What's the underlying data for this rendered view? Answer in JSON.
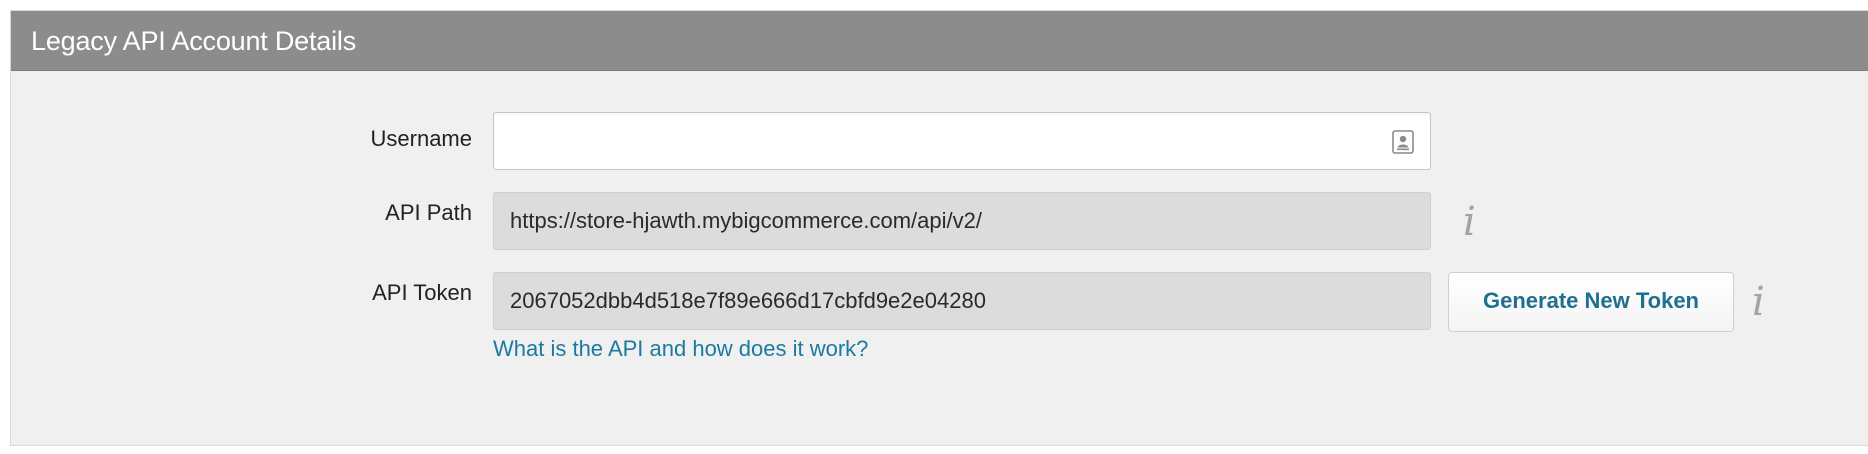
{
  "panel": {
    "title": "Legacy API Account Details"
  },
  "form": {
    "username": {
      "label": "Username",
      "value": "",
      "placeholder": ""
    },
    "api_path": {
      "label": "API Path",
      "value": "https://store-hjawth.mybigcommerce.com/api/v2/",
      "info_glyph": "i"
    },
    "api_token": {
      "label": "API Token",
      "value": "2067052dbb4d518e7f89e666d17cbfd9e2e04280",
      "generate_button": "Generate New Token",
      "info_glyph": "i"
    },
    "help_link": "What is the API and how does it work?"
  },
  "icons": {
    "username_field_icon": "contact-card-icon",
    "api_path_info": "info-icon",
    "api_token_info": "info-icon"
  },
  "colors": {
    "header_bg": "#8c8c8c",
    "panel_bg": "#f0f0f0",
    "link": "#1b7aa0",
    "button_text": "#1f6f90",
    "readonly_bg": "#dcdcdc"
  }
}
